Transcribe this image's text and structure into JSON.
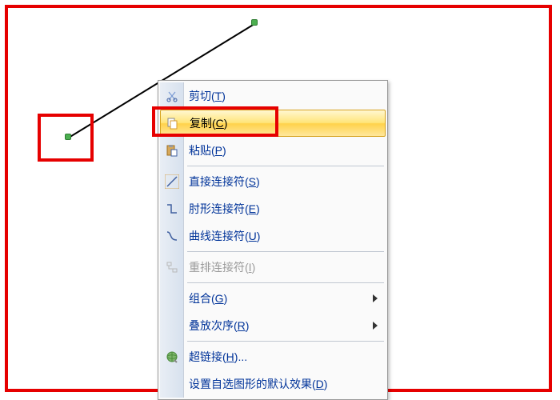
{
  "menu": {
    "cut": {
      "text": "剪切",
      "hotkey": "T"
    },
    "copy": {
      "text": "复制",
      "hotkey": "C"
    },
    "paste": {
      "text": "粘贴",
      "hotkey": "P"
    },
    "straight": {
      "text": "直接连接符",
      "hotkey": "S"
    },
    "elbow": {
      "text": "肘形连接符",
      "hotkey": "E"
    },
    "curve": {
      "text": "曲线连接符",
      "hotkey": "U"
    },
    "reroute": {
      "text": "重排连接符",
      "hotkey": "I"
    },
    "group": {
      "text": "组合",
      "hotkey": "G"
    },
    "order": {
      "text": "叠放次序",
      "hotkey": "R"
    },
    "hyperlink": {
      "text": "超链接",
      "hotkey": "H",
      "suffix": "..."
    },
    "defaults": {
      "text": "设置自选图形的默认效果",
      "hotkey": "D"
    }
  },
  "icons": {
    "cut": "cut-icon",
    "copy": "copy-icon",
    "paste": "paste-icon",
    "straight": "straight-connector-icon",
    "elbow": "elbow-connector-icon",
    "curve": "curve-connector-icon",
    "reroute": "reroute-icon",
    "hyperlink": "hyperlink-icon"
  }
}
